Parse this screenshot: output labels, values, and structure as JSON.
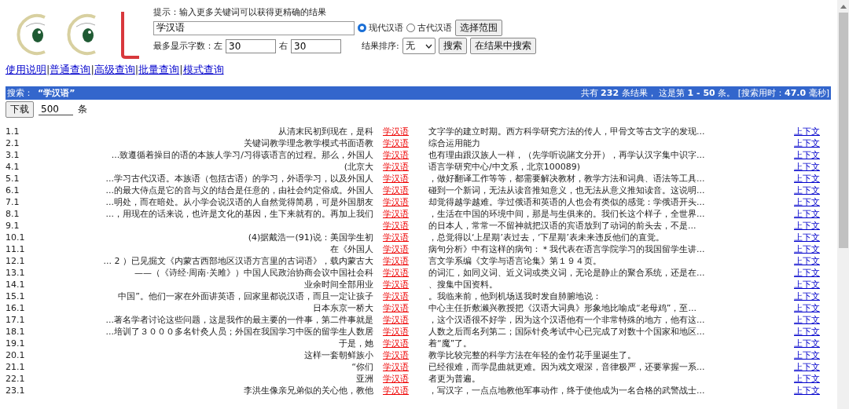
{
  "search_form": {
    "hint": "提示：输入更多关键词可以获得更精确的结果",
    "query": "学汉语",
    "corpora": [
      {
        "label": "现代汉语",
        "selected": true
      },
      {
        "label": "古代汉语",
        "selected": false
      }
    ],
    "scope_button": "选择范围",
    "max_chars_label": "最多显示字数：",
    "left_label": "左",
    "left_value": "30",
    "right_label": "右",
    "right_value": "30",
    "sort_label": "结果排序:",
    "sort_value": "无",
    "search_button": "搜索",
    "search_in_results_button": "在结果中搜索"
  },
  "nav_links": [
    "使用说明",
    "普通查询",
    "高级查询",
    "批量查询",
    "模式查询"
  ],
  "nav_separator": "|",
  "summary_bar": {
    "query_label": "搜索：",
    "query": "“学汉语”",
    "stats": "共有 **232** 条结果， 这是第 **1 - 50** 条。 [搜索用时：**47.0** 毫秒]"
  },
  "download": {
    "button": "下载",
    "count": "500",
    "unit": "条"
  },
  "results": [
    {
      "number": "1.1",
      "left": "从清末民初到现在，是科",
      "keyword": "学汉语",
      "right": "文字学的建立时期。西方科学研究方法的传人，甲骨文等古文字的发现...",
      "context_link": "上下文"
    },
    {
      "number": "2.1",
      "left": "关键词教学理念教学模式书面语教",
      "keyword": "学汉语",
      "right": "综合运用能力",
      "context_link": "上下文"
    },
    {
      "number": "3.1",
      "left": "...致遵循着操目的语的本族人学习/习得该语言的过程。那么，外国人",
      "keyword": "学汉语",
      "right": "也有理由跟汉族人一样，（先学听说賭文分开），再学认汉字集中识字...",
      "context_link": "上下文"
    },
    {
      "number": "4.1",
      "left": "(北京大",
      "keyword": "学汉语",
      "right": "语言学研究中心/中文系，北京100089)",
      "context_link": "上下文"
    },
    {
      "number": "5.1",
      "left": "...学习古代汉语。本族语（包括古语）的学习，外语学习，以及外国人",
      "keyword": "学汉语",
      "right": "，做好翻译工作等等，都需要解决教材，教学方法和词典、语法等工具...",
      "context_link": "上下文"
    },
    {
      "number": "6.1",
      "left": "...的最大侍点是它的音与义的结合是任意的，由社会约定俗成。外国人",
      "keyword": "学汉语",
      "right": "碰到一个新词，无法从读音推知意义，也无法从意义推知读音。这说明...",
      "context_link": "上下文"
    },
    {
      "number": "7.1",
      "left": "...明处，而在暗处。从小学会说汉语的人自然觉得简易，可是外国朋友",
      "keyword": "学汉语",
      "right": "却觉得越学越难。学过俄语和英语的人也会有类似的感觉：学俄语开头...",
      "context_link": "上下文"
    },
    {
      "number": "8.1",
      "left": "...，用现在的话来说，也许是文化的基因，生下来就有的。再加上我们",
      "keyword": "学汉语",
      "right": "，生活在中国的环境中间，那是与生俱来的。我们长这个样子，全世界...",
      "context_link": "上下文"
    },
    {
      "number": "9.1",
      "keyword": "学汉语",
      "right": "的日本人，常常一不留神就把汉语的宾语放到了动词的前头去，不是...",
      "context_link": "上下文"
    },
    {
      "number": "10.1",
      "left": "(4)据戴浩一(91)说：美国学生初",
      "keyword": "学汉语",
      "right": "，总觉得以‘上星期’表过去，‘下星期’表未来违反他们的直觉。",
      "context_link": "上下文"
    },
    {
      "number": "11.1",
      "left": "在《外国人",
      "keyword": "学汉语",
      "right": "病句分析》中有这样的病句：＊我代表在语言学院学习的我国留学生讲...",
      "context_link": "上下文"
    },
    {
      "number": "12.1",
      "left": "... 2 ）已见掘文《内蒙古西部地区汉语方言里的古词语》，载内蒙古大",
      "keyword": "学汉语",
      "right": "言文学系编《文学与语言论集》第１９４页。",
      "context_link": "上下文"
    },
    {
      "number": "13.1",
      "left": "——（《诗经·周南·关雎》）中国人民政治协商会议中国社会科",
      "keyword": "学汉语",
      "right": "的词汇，如同义词、近义词或类义词，无论是静止的聚合系统，还是在...",
      "context_link": "上下文"
    },
    {
      "number": "14.1",
      "left": "业余时间全部用业",
      "keyword": "学汉语",
      "right": "、搜集中国资料。",
      "context_link": "上下文"
    },
    {
      "number": "15.1",
      "left": "中国”。他们一家在外面讲英语，回家里都说汉语，而且一定让孩子",
      "keyword": "学汉语",
      "right": "。我临来前，他到机场送我时发自肺腑地说：",
      "context_link": "上下文"
    },
    {
      "number": "16.1",
      "left": "日本东京一桥大",
      "keyword": "学汉语",
      "right": "中心主任折敷濑兴教授把《汉语大词典》形象地比喻成“老母鸡”，至...",
      "context_link": "上下文"
    },
    {
      "number": "17.1",
      "left": "...著名学者讨论这些问题，这是我作的最主要的一件事，第二件事就是",
      "keyword": "学汉语",
      "right": "，这个汉语很不好学，因为这个汉语他有一个非常特殊的地方，他有这...",
      "context_link": "上下文"
    },
    {
      "number": "18.1",
      "left": "...培训了３０００多名针灸人员；外国在我国学习中医的留学生人数居",
      "keyword": "学汉语",
      "right": "人数之后而名列第二；国际针灸考试中心已完成了对数十个国家和地区...",
      "context_link": "上下文"
    },
    {
      "number": "19.1",
      "left": "于是，她",
      "keyword": "学汉语",
      "right": "着“魔”了。",
      "context_link": "上下文"
    },
    {
      "number": "20.1",
      "left": "这样一套朝鲜族小",
      "keyword": "学汉语",
      "right": "教学比较完整的科学方法在年轻的金竹花手里诞生了。",
      "context_link": "上下文"
    },
    {
      "number": "21.1",
      "left": "“你们",
      "keyword": "学汉语",
      "right": "已经很难，而学昆曲就更难。因为戏文艰深，音律极严，还要掌握一系...",
      "context_link": "上下文"
    },
    {
      "number": "22.1",
      "left": "亚洲",
      "keyword": "学汉语",
      "right": "者更为普遍。",
      "context_link": "上下文"
    },
    {
      "number": "23.1",
      "left": "李洪生像亲兄弟似的关心他，教他",
      "keyword": "学汉语",
      "right": "，写汉字，一点点地教他军事动作，终于使他成为一名合格的武警战士...",
      "context_link": "上下文"
    }
  ]
}
